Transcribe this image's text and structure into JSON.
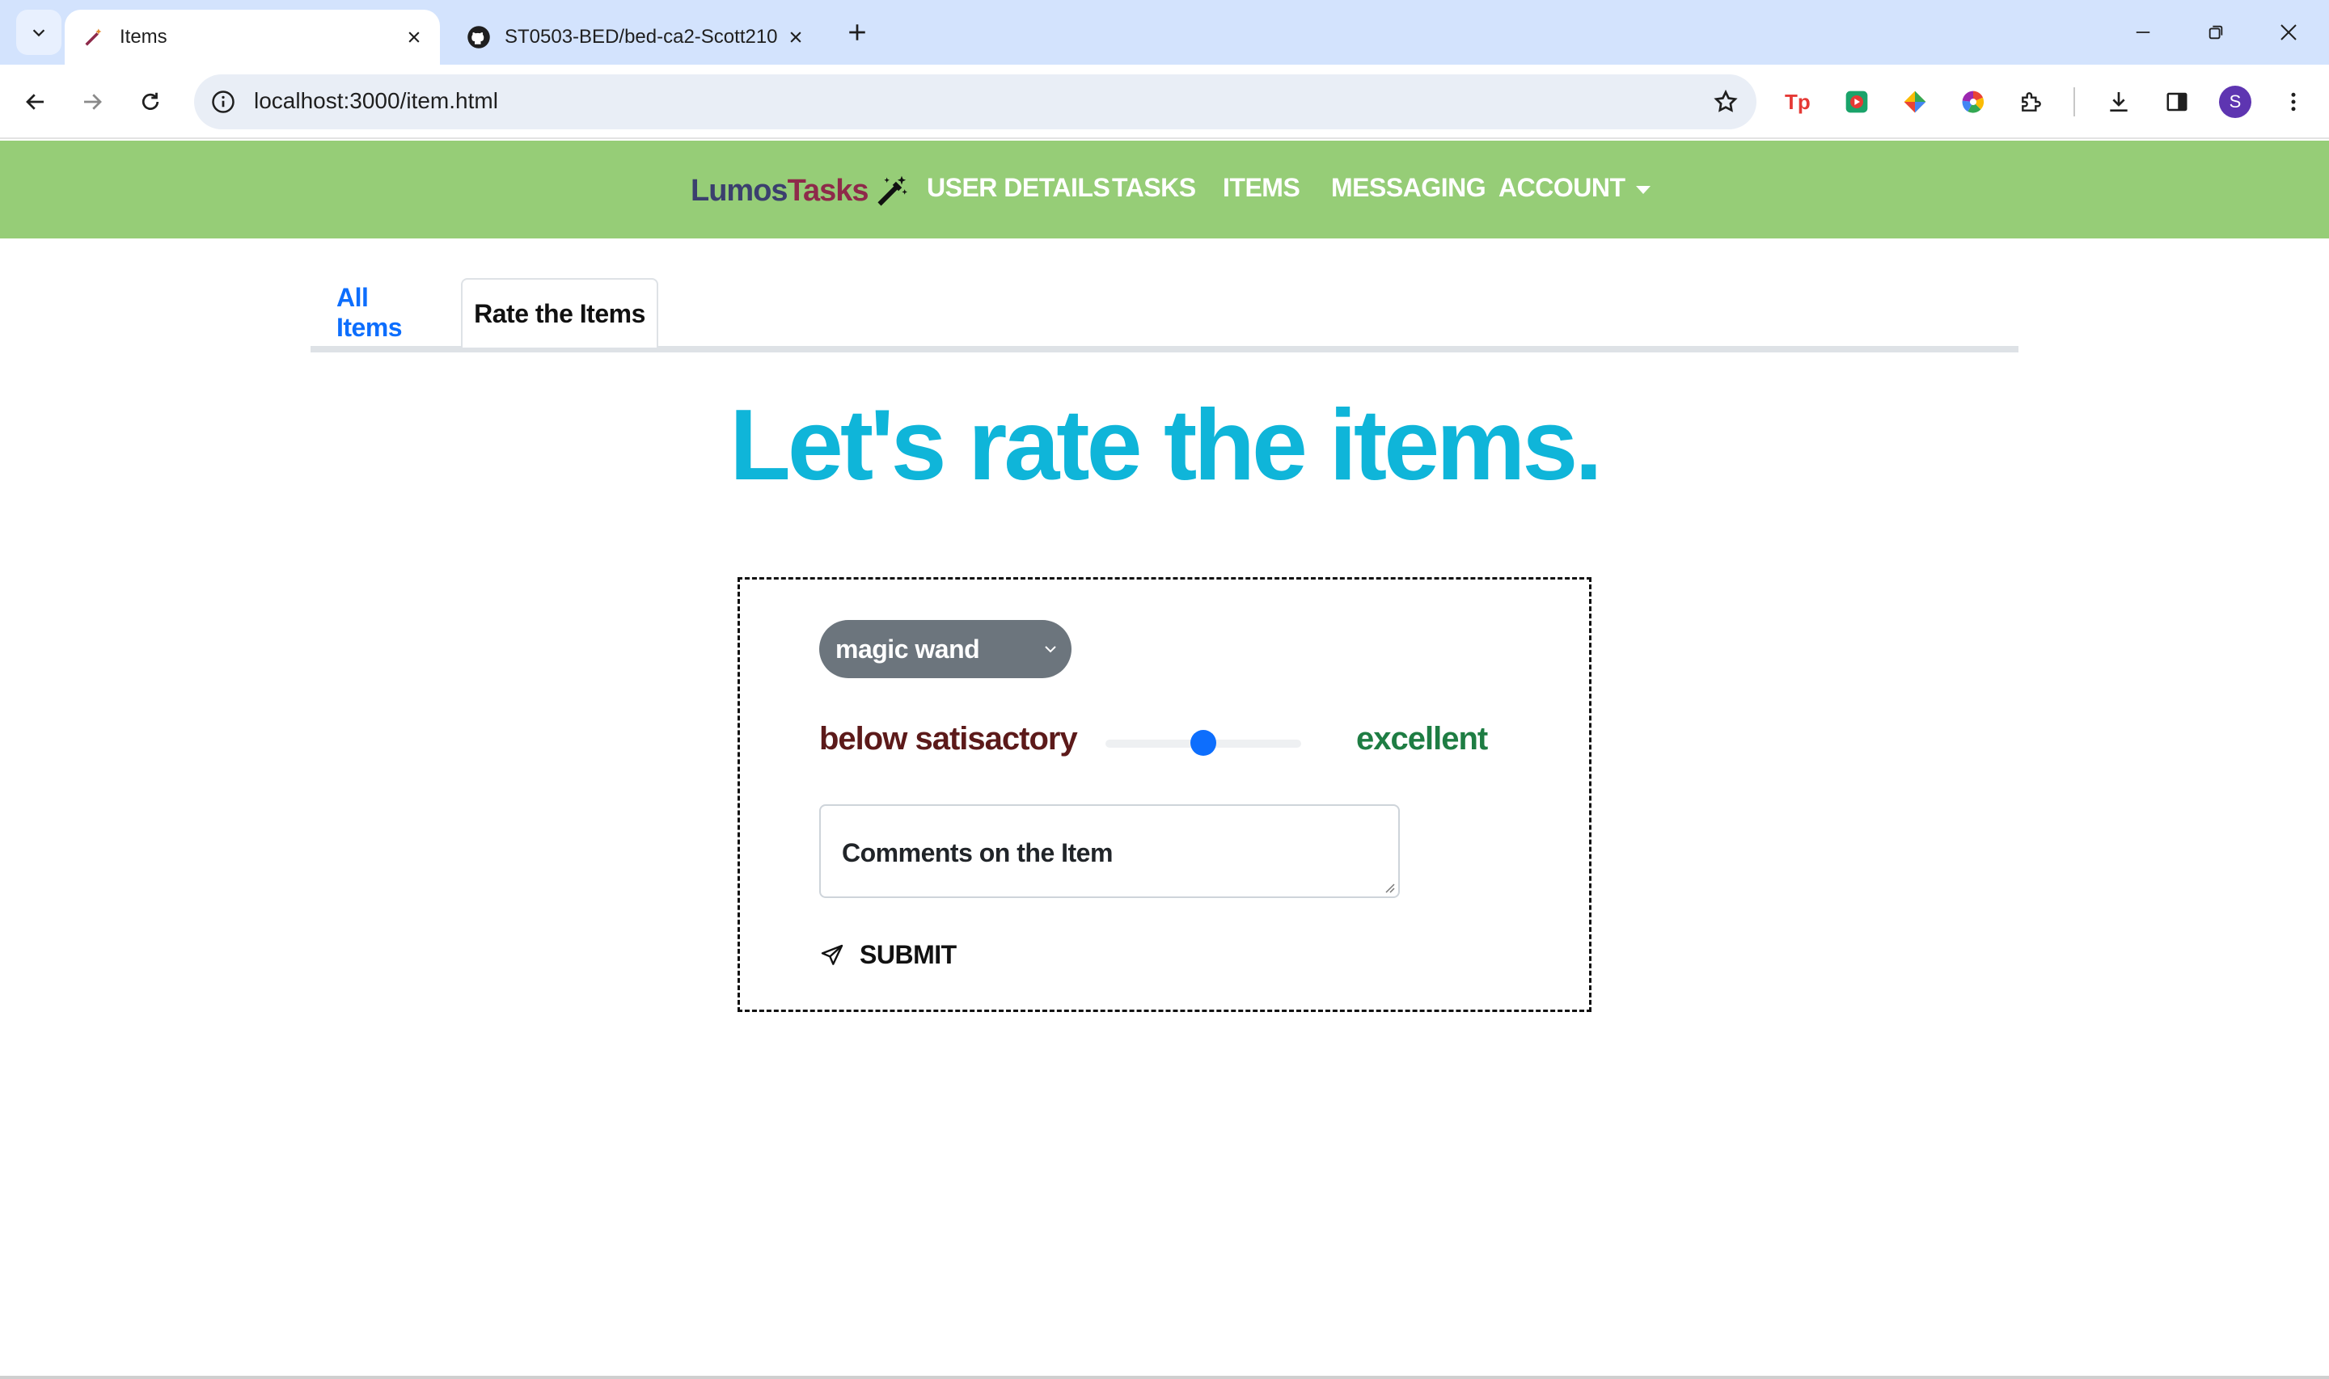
{
  "browser": {
    "tabs": [
      {
        "title": "Items",
        "active": true
      },
      {
        "title": "ST0503-BED/bed-ca2-Scott210",
        "active": false
      }
    ],
    "url": "localhost:3000/item.html",
    "profile_initial": "S"
  },
  "navbar": {
    "brand_part1": "Lumos",
    "brand_part2": "Tasks",
    "links": [
      "USER DETAILS",
      "TASKS",
      "ITEMS",
      "MESSAGING",
      "ACCOUNT"
    ],
    "background_color": "#96cd77"
  },
  "page_tabs": {
    "all_items": "All Items",
    "rate_items": "Rate the Items"
  },
  "heading": "Let's rate the items.",
  "form": {
    "selected_item": "magic wand",
    "rating_low_label": "below satisactory",
    "rating_high_label": "excellent",
    "rating_value_fraction": 0.5,
    "comments_placeholder": "Comments on the Item",
    "submit_label": "SUBMIT"
  },
  "colors": {
    "heading": "#0fb5d9",
    "tab_link": "#0d6efd",
    "low_label": "#5c1a1a",
    "high_label": "#1e7d43"
  }
}
